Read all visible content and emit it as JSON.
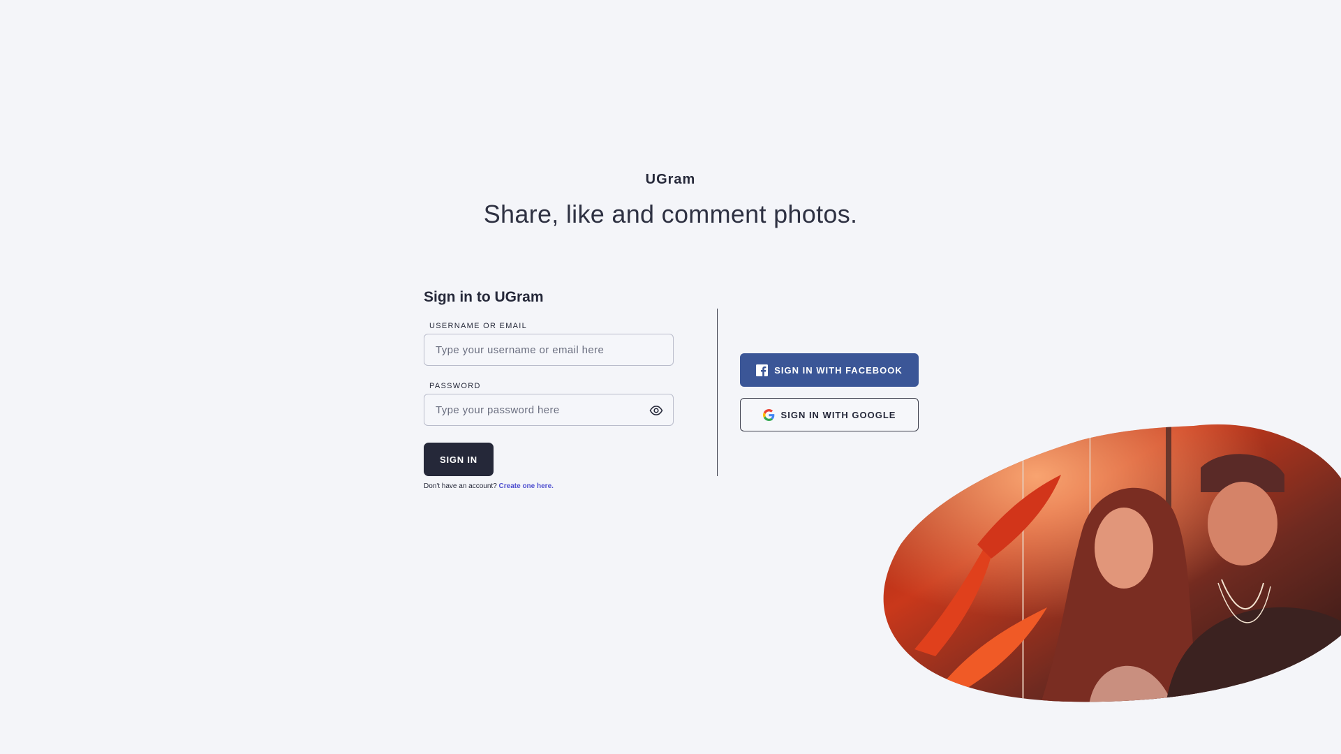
{
  "header": {
    "brand": "UGram",
    "tagline": "Share, like and comment photos."
  },
  "signin_form": {
    "title": "Sign in to UGram",
    "username_label": "USERNAME OR EMAIL",
    "username_placeholder": "Type your username or email here",
    "username_value": "",
    "password_label": "PASSWORD",
    "password_placeholder": "Type your password here",
    "password_value": "",
    "submit_label": "SIGN IN",
    "signup_prompt": "Don't have an account?",
    "signup_link": "Create one here."
  },
  "social": {
    "facebook_label": "SIGN IN WITH FACEBOOK",
    "google_label": "SIGN IN WITH GOOGLE"
  },
  "icons": {
    "password_toggle": "eye-icon",
    "facebook": "facebook-icon",
    "google": "google-icon"
  },
  "colors": {
    "background": "#f4f5f9",
    "primary": "#252839",
    "facebook": "#3b5697",
    "link": "#4e4fcf"
  }
}
